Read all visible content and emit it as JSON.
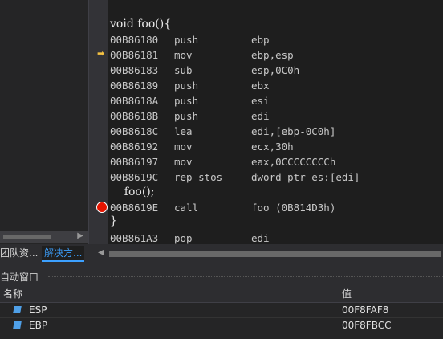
{
  "left_panel": {
    "tabs": [
      "团队资...",
      "解决方..."
    ]
  },
  "editor": {
    "lines": [
      {
        "type": "src",
        "text": "void foo(){"
      },
      {
        "addr": "00B86180",
        "op": "push",
        "args": "ebp"
      },
      {
        "addr": "00B86181",
        "op": "mov",
        "args": "ebp,esp"
      },
      {
        "addr": "00B86183",
        "op": "sub",
        "args": "esp,0C0h"
      },
      {
        "addr": "00B86189",
        "op": "push",
        "args": "ebx"
      },
      {
        "addr": "00B8618A",
        "op": "push",
        "args": "esi"
      },
      {
        "addr": "00B8618B",
        "op": "push",
        "args": "edi"
      },
      {
        "addr": "00B8618C",
        "op": "lea",
        "args": "edi,[ebp-0C0h]"
      },
      {
        "addr": "00B86192",
        "op": "mov",
        "args": "ecx,30h"
      },
      {
        "addr": "00B86197",
        "op": "mov",
        "args": "eax,0CCCCCCCCh"
      },
      {
        "addr": "00B8619C",
        "op": "rep stos",
        "args": "dword ptr es:[edi]"
      },
      {
        "type": "src",
        "text": "    foo();"
      },
      {
        "addr": "00B8619E",
        "op": "call",
        "args": "foo (0B814D3h)"
      },
      {
        "type": "src",
        "text": "}"
      },
      {
        "addr": "00B861A3",
        "op": "pop",
        "args": "edi"
      }
    ]
  },
  "autos": {
    "title": "自动窗口",
    "columns": {
      "name": "名称",
      "value": "值"
    },
    "rows": [
      {
        "name": "ESP",
        "value": "00F8FAF8"
      },
      {
        "name": "EBP",
        "value": "00F8FBCC"
      }
    ]
  }
}
